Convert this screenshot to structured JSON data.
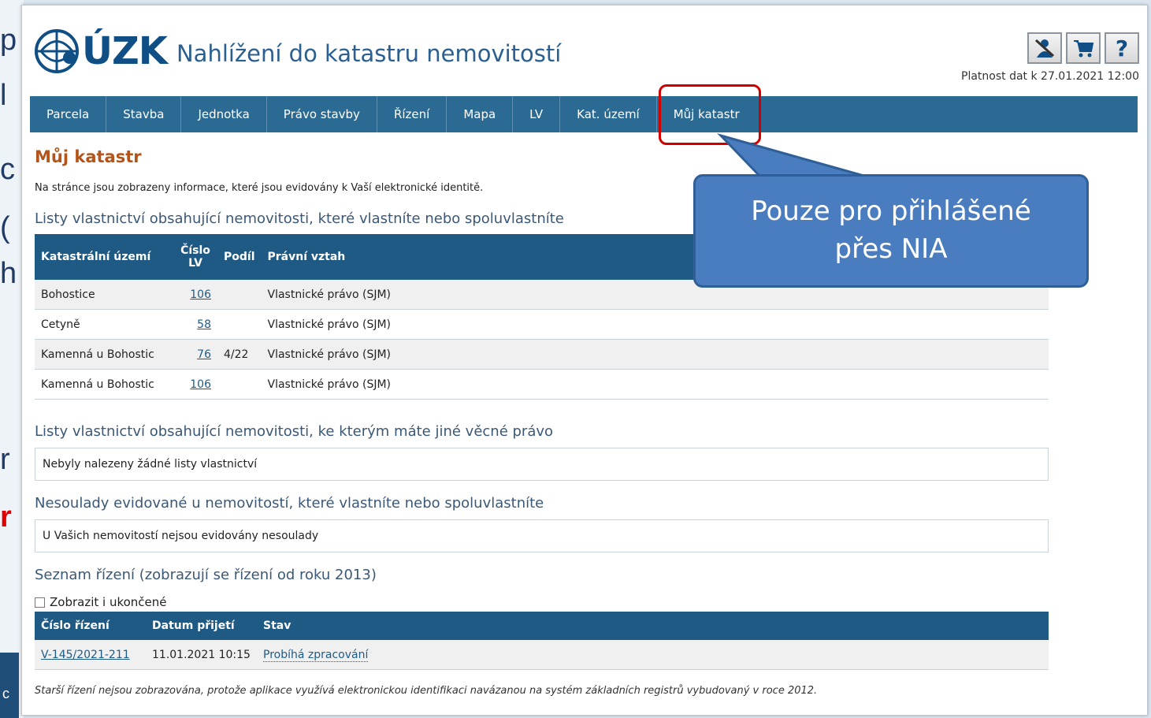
{
  "background_slide": {
    "fragments": [
      "p",
      "l",
      "c",
      "(",
      "h",
      "r",
      "r"
    ]
  },
  "header": {
    "logo_text": "ÚZK",
    "app_title": "Nahlížení do katastru nemovitostí",
    "validity": "Platnost dat k 27.01.2021 12:00",
    "icons": [
      "person-icon",
      "cart-icon",
      "help-icon"
    ],
    "help_glyph": "?"
  },
  "nav": {
    "items": [
      "Parcela",
      "Stavba",
      "Jednotka",
      "Právo stavby",
      "Řízení",
      "Mapa",
      "LV",
      "Kat. území",
      "Můj katastr"
    ]
  },
  "page": {
    "title": "Můj katastr",
    "intro": "Na stránce jsou zobrazeny informace, které jsou evidovány k Vaší elektronické identitě.",
    "section1": {
      "heading": "Listy vlastnictví obsahující nemovitosti, které vlastníte nebo spoluvlastníte",
      "columns": [
        "Katastrální území",
        "Číslo LV",
        "Podíl",
        "Právní vztah"
      ],
      "rows": [
        {
          "ku": "Bohostice",
          "lv": "106",
          "podil": "",
          "vztah": "Vlastnické právo (SJM)"
        },
        {
          "ku": "Cetyně",
          "lv": "58",
          "podil": "",
          "vztah": "Vlastnické právo (SJM)"
        },
        {
          "ku": "Kamenná u Bohostic",
          "lv": "76",
          "podil": "4/22",
          "vztah": "Vlastnické právo (SJM)"
        },
        {
          "ku": "Kamenná u Bohostic",
          "lv": "106",
          "podil": "",
          "vztah": "Vlastnické právo (SJM)"
        }
      ]
    },
    "section2": {
      "heading": "Listy vlastnictví obsahující nemovitosti, ke kterým máte jiné věcné právo",
      "message": "Nebyly nalezeny žádné listy vlastnictví"
    },
    "section3": {
      "heading": "Nesoulady evidované u nemovitostí, které vlastníte nebo spoluvlastníte",
      "message": "U Vašich nemovitostí nejsou evidovány nesoulady"
    },
    "section4": {
      "heading": "Seznam řízení (zobrazují se řízení od roku 2013)",
      "checkbox_label": "Zobrazit i ukončené",
      "columns": [
        "Číslo řízení",
        "Datum přijetí",
        "Stav"
      ],
      "rows": [
        {
          "cislo": "V-145/2021-211",
          "datum": "11.01.2021 10:15",
          "stav": "Probíhá zpracování"
        }
      ]
    },
    "footnote": "Starší řízení nejsou zobrazována, protože aplikace využívá elektronickou identifikaci navázanou na systém základních registrů vybudovaný v roce 2012."
  },
  "callout": {
    "line1": "Pouze pro přihlášené",
    "line2": "přes NIA"
  },
  "colors": {
    "nav": "#2b6a93",
    "table_header": "#1f5a85",
    "title": "#b4541a",
    "callout": "#4a7dbf",
    "highlight": "#d10000"
  }
}
